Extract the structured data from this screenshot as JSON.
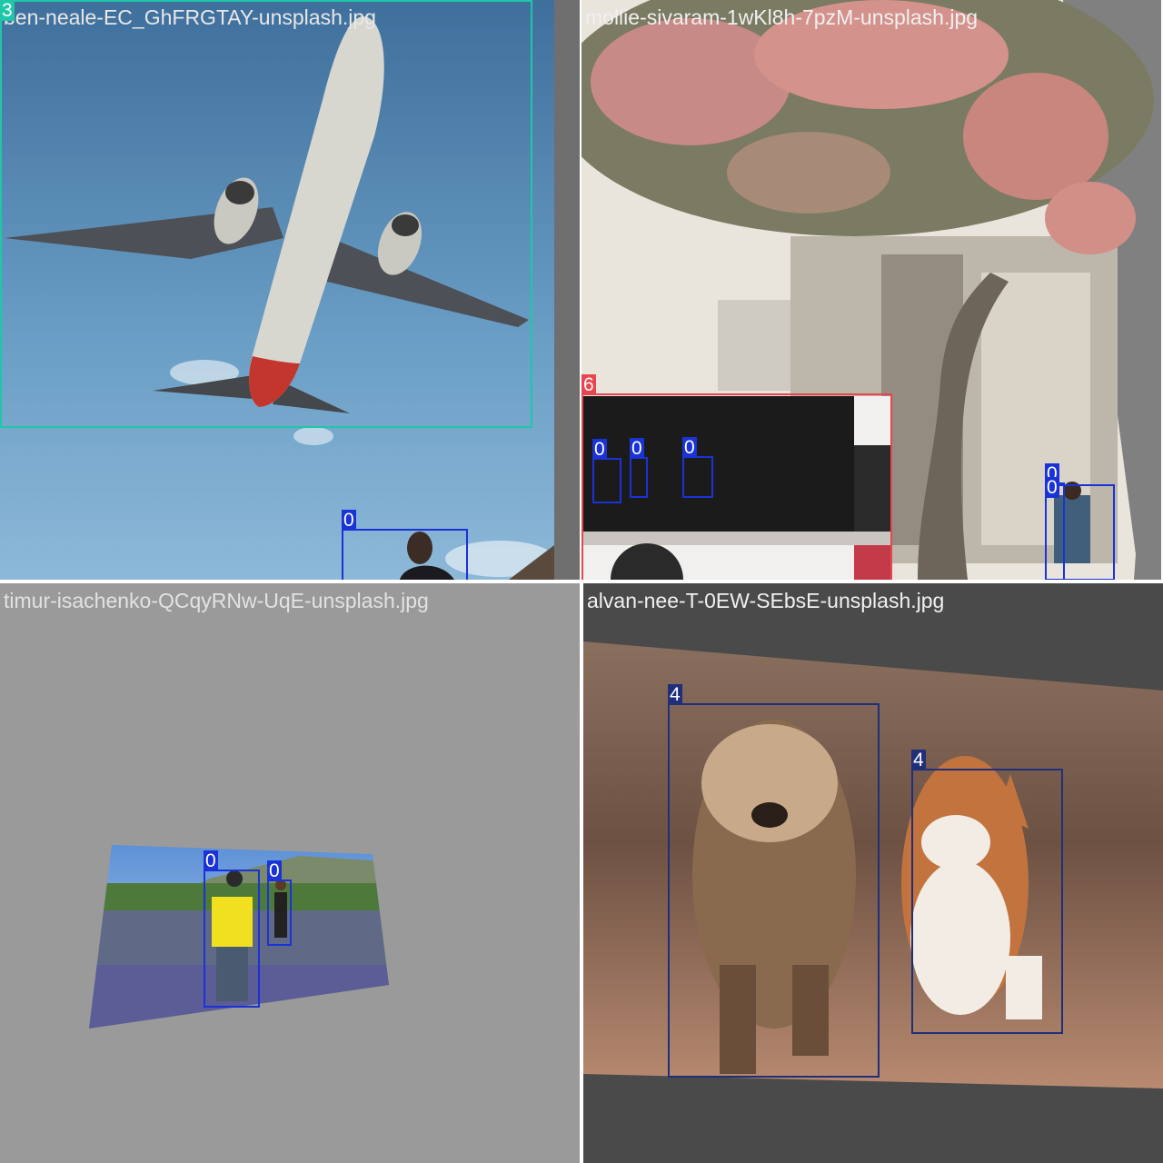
{
  "tiles": [
    {
      "filename": "ben-neale-EC_GhFRGTAY-unsplash.jpg",
      "filename_color": "#e8e8e8",
      "fill_color": "#6f6f6f",
      "detections": [
        {
          "label": "3",
          "color": "#1fc7a8"
        },
        {
          "label": "0",
          "color": "#1a33d6"
        }
      ]
    },
    {
      "filename": "mollie-sivaram-1wKl8h-7pzM-unsplash.jpg",
      "filename_color": "#f0f0f0",
      "fill_color": "#808080",
      "detections": [
        {
          "label": "6",
          "color": "#e8454f"
        },
        {
          "label": "0",
          "color": "#1a33d6"
        },
        {
          "label": "0",
          "color": "#1a33d6"
        },
        {
          "label": "0",
          "color": "#1a33d6"
        },
        {
          "label": "0",
          "color": "#1a33d6"
        },
        {
          "label": "0",
          "color": "#1a33d6"
        }
      ]
    },
    {
      "filename": "timur-isachenko-QCqyRNw-UqE-unsplash.jpg",
      "filename_color": "#e2e2e2",
      "fill_color": "#9a9a9a",
      "detections": [
        {
          "label": "0",
          "color": "#1a33d6"
        },
        {
          "label": "0",
          "color": "#1a33d6"
        }
      ]
    },
    {
      "filename": "alvan-nee-T-0EW-SEbsE-unsplash.jpg",
      "filename_color": "#f0f0f0",
      "fill_color": "#4a4a4a",
      "detections": [
        {
          "label": "4",
          "color": "#1f2f7a"
        },
        {
          "label": "4",
          "color": "#1f2f7a"
        }
      ]
    }
  ]
}
